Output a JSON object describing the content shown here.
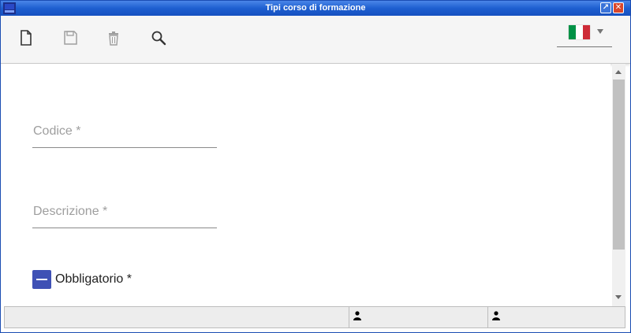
{
  "window": {
    "title": "Tipi corso di formazione",
    "maximize_glyph": "↗",
    "close_glyph": "✕"
  },
  "toolbar": {
    "icons": [
      "new-document-icon",
      "save-icon",
      "delete-icon",
      "search-icon"
    ],
    "language": {
      "selected": "it",
      "flag_colors": [
        "#009246",
        "#ffffff",
        "#ce2b37"
      ]
    }
  },
  "form": {
    "code_label": "Codice *",
    "code_value": "",
    "description_label": "Descrizione *",
    "description_value": "",
    "mandatory_label": "Obbligatorio *",
    "mandatory_state": "indeterminate"
  },
  "statusbar": {
    "cells": [
      "",
      "",
      ""
    ],
    "user_icons": [
      "user-icon",
      "user-icon"
    ]
  },
  "colors": {
    "titlebar": "#1e5fd0",
    "accent": "#3f51b5",
    "toolbar_bg": "#f5f5f5"
  }
}
